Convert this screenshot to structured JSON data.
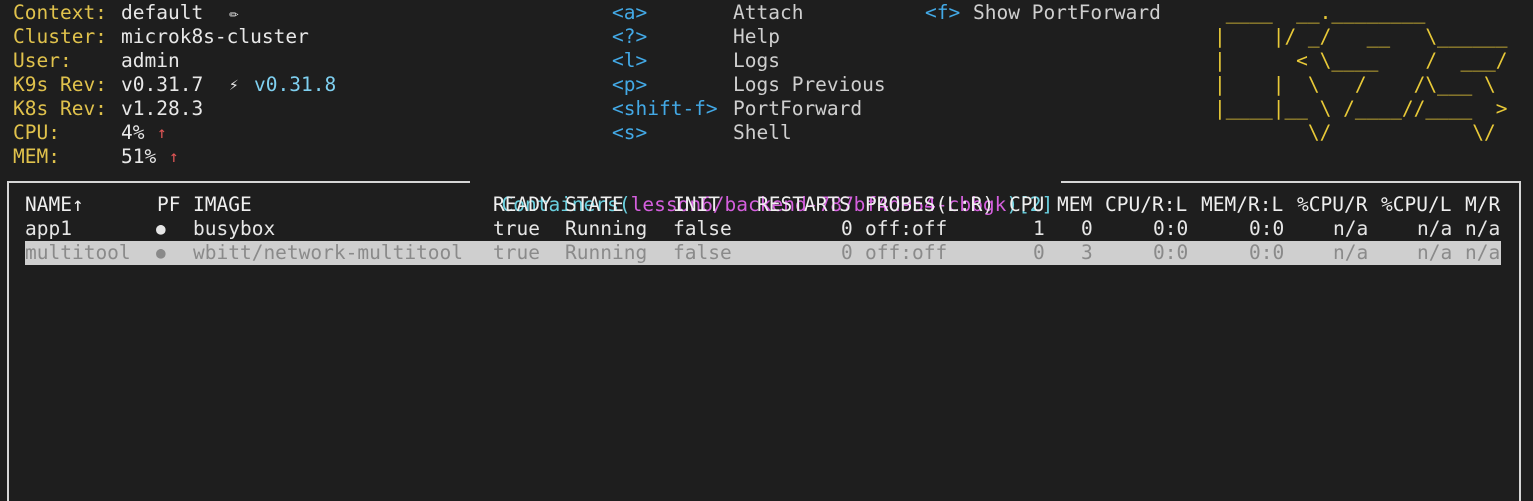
{
  "info": {
    "context_label": "Context:",
    "context_value": "default",
    "context_edit_icon": "pencil-icon",
    "context_edit_glyph": "✏",
    "cluster_label": "Cluster:",
    "cluster_value": "microk8s-cluster",
    "user_label": "User:",
    "user_value": "admin",
    "k9s_rev_label": "K9s Rev:",
    "k9s_rev_value": "v0.31.7",
    "k9s_rev_bolt": "⚡",
    "k9s_rev_new": "v0.31.8",
    "k8s_rev_label": "K8s Rev:",
    "k8s_rev_value": "v1.28.3",
    "cpu_label": "CPU:",
    "cpu_value": "4%",
    "mem_label": "MEM:",
    "mem_value": "51%",
    "trend_up_glyph": "↑"
  },
  "keys": [
    {
      "key": "<a>",
      "desc": "Attach"
    },
    {
      "key": "<?>",
      "desc": "Help"
    },
    {
      "key": "<l>",
      "desc": "Logs"
    },
    {
      "key": "<p>",
      "desc": "Logs Previous"
    },
    {
      "key": "<shift-f>",
      "desc": "PortForward"
    },
    {
      "key": "<s>",
      "desc": "Shell"
    }
  ],
  "keys2": [
    {
      "key": "<f>",
      "desc": "Show PortForward"
    }
  ],
  "logo_lines": [
    " ____  __.________       ",
    "|    |/ _/   __   \\______",
    "|      < \\____    /  ___/",
    "|    |  \\   /    /\\___ \\ ",
    "|____|__ \\ /____//____  >",
    "        \\/            \\/ "
  ],
  "view": {
    "title_prefix": "Containers(",
    "title_path": "lesson6/backend-787bf4d954-cbbgk",
    "title_suffix": ")",
    "title_count": "[2]"
  },
  "table": {
    "columns": [
      "NAME↑",
      "PF",
      "IMAGE",
      "READY",
      "STATE",
      "INIT",
      "RESTARTS",
      "PROBES(L:R)",
      "CPU",
      "MEM",
      "CPU/R:L",
      "MEM/R:L",
      "%CPU/R",
      "%CPU/L",
      "M/R"
    ],
    "rows": [
      [
        "app1",
        "●",
        "busybox",
        "true",
        "Running",
        "false",
        "0",
        "off:off",
        "1",
        "0",
        "0:0",
        "0:0",
        "n/a",
        "n/a",
        "n/a"
      ],
      [
        "multitool",
        "●",
        "wbitt/network-multitool",
        "true",
        "Running",
        "false",
        "0",
        "off:off",
        "0",
        "3",
        "0:0",
        "0:0",
        "n/a",
        "n/a",
        "n/a"
      ]
    ],
    "selected_row": 1
  },
  "colors": {
    "background": "#1e1e1e",
    "label_yellow": "#e0c24c",
    "key_blue": "#43a9e6",
    "logo_yellow": "#e8c938",
    "title_teal": "#6ad0df",
    "title_magenta": "#d55fde",
    "alert_red": "#e05555",
    "selection_bg": "#cfcfcf"
  }
}
